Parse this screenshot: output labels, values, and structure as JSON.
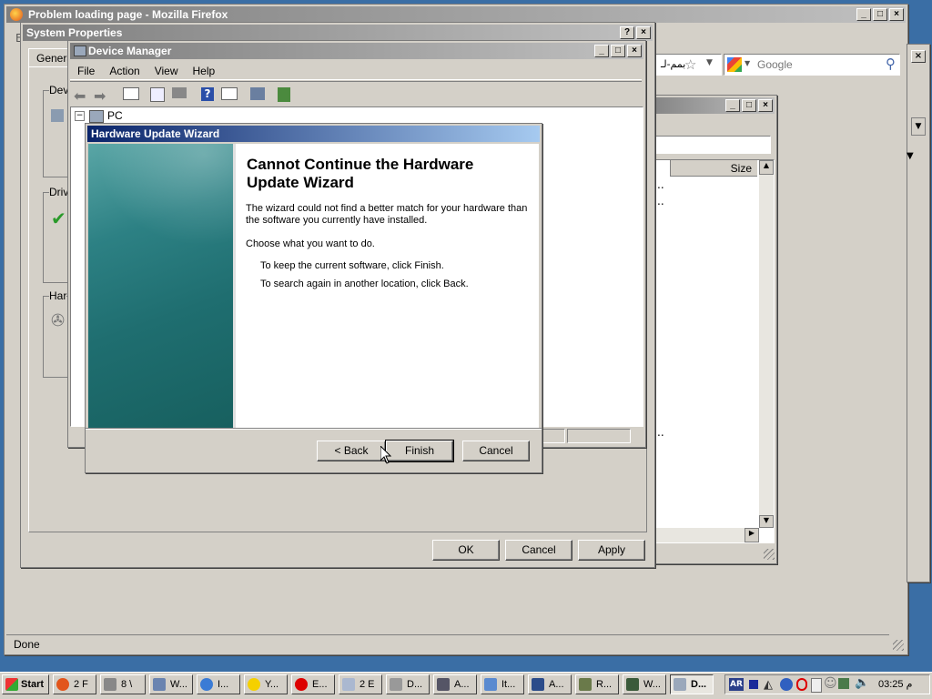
{
  "firefox": {
    "title": "Problem loading page - Mozilla Firefox",
    "menu_letter": "E",
    "search_placeholder": "Google",
    "url_fragment": "بمم-لـ",
    "status": "Done"
  },
  "explorer_window": {
    "column_size": "Size",
    "dots": [
      "..",
      "..",
      ".."
    ]
  },
  "system_properties": {
    "title": "System Properties",
    "tab": "Genera",
    "groups": [
      "Dev",
      "Driv",
      "Har"
    ],
    "buttons": {
      "ok": "OK",
      "cancel": "Cancel",
      "apply": "Apply"
    }
  },
  "device_manager": {
    "title": "Device Manager",
    "menu": [
      "File",
      "Action",
      "View",
      "Help"
    ],
    "tree_root": "PC"
  },
  "wizard": {
    "title": "Hardware Update Wizard",
    "heading": "Cannot Continue the Hardware Update Wizard",
    "message": "The wizard could not find a better match for your hardware than the software you currently have installed.",
    "prompt": "Choose what you want to do.",
    "option1": "To keep the current software, click Finish.",
    "option2": "To search again in another location, click Back.",
    "buttons": {
      "back": "< Back",
      "finish": "Finish",
      "cancel": "Cancel"
    }
  },
  "taskbar": {
    "start": "Start",
    "items": [
      "2 F",
      "8 \\",
      "W...",
      "I...",
      "Y...",
      "E...",
      "2 E",
      "D...",
      "A...",
      "It...",
      "A...",
      "R...",
      "W...",
      "D..."
    ],
    "tray_lang": "AR",
    "clock": "03:25 م"
  },
  "colors": {
    "title_active": "#0a246a",
    "title_inactive": "#7f7f7f",
    "wizard_banner": "#1f6e70",
    "desktop": "#3a6ea5"
  }
}
